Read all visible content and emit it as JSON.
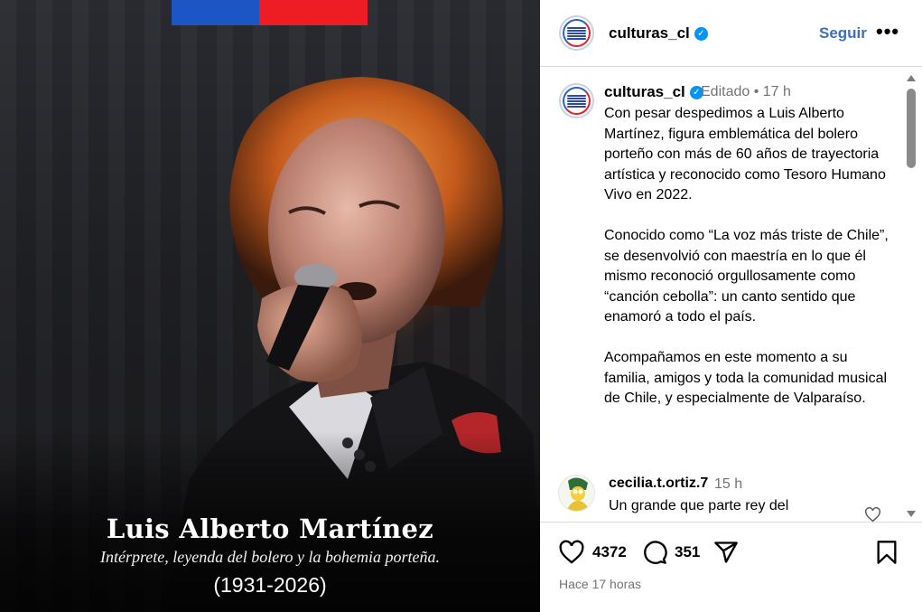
{
  "post": {
    "caption_name": "Luis Alberto Martínez",
    "caption_subtitle": "Intérprete, leyenda del bolero y la bohemia porteña.",
    "caption_years": "(1931-2026)"
  },
  "header": {
    "username": "culturas_cl",
    "follow_label": "Seguir",
    "more_label": "•••"
  },
  "caption": {
    "username": "culturas_cl",
    "meta": "Editado  •  17 h",
    "text": "Con pesar despedimos a Luis Alberto Martínez, figura emblemática del bolero porteño con más de 60 años de trayectoria artística y reconocido como Tesoro Humano Vivo en 2022.\n\nConocido como “La voz más triste de Chile”, se desenvolvió con maestría en lo que él mismo reconoció orgullosamente como “canción cebolla”: un canto sentido que enamoró a todo el país.\n\nAcompañamos en este momento a su familia, amigos y toda la comunidad musical de Chile, y especialmente de Valparaíso."
  },
  "comment": {
    "username": "cecilia.t.ortiz.7",
    "time": "15 h",
    "text": "Un grande que parte rey del"
  },
  "actions": {
    "likes": "4372",
    "comments": "351",
    "posted": "Hace 17 horas"
  },
  "colors": {
    "follow_blue": "#3d6fbc",
    "verified_blue": "#0095f6",
    "flag_blue": "#1d55c4",
    "flag_red": "#ee1c25"
  },
  "icons": [
    "verified-icon",
    "heart-icon",
    "comment-icon",
    "share-icon",
    "bookmark-icon",
    "more-icon"
  ]
}
